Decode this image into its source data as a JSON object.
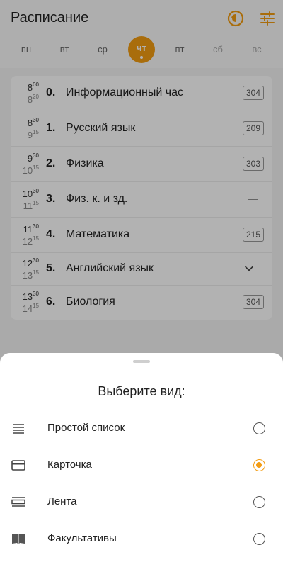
{
  "header": {
    "title": "Расписание"
  },
  "days": [
    {
      "label": "пн",
      "state": "normal"
    },
    {
      "label": "вт",
      "state": "normal"
    },
    {
      "label": "ср",
      "state": "normal"
    },
    {
      "label": "чт",
      "state": "active"
    },
    {
      "label": "пт",
      "state": "normal"
    },
    {
      "label": "сб",
      "state": "muted"
    },
    {
      "label": "вс",
      "state": "muted"
    }
  ],
  "lessons": [
    {
      "start_h": "8",
      "start_m": "00",
      "end_h": "8",
      "end_m": "20",
      "num": "0.",
      "subject": "Информационный час",
      "room": "304"
    },
    {
      "start_h": "8",
      "start_m": "30",
      "end_h": "9",
      "end_m": "15",
      "num": "1.",
      "subject": "Русский язык",
      "room": "209"
    },
    {
      "start_h": "9",
      "start_m": "30",
      "end_h": "10",
      "end_m": "15",
      "num": "2.",
      "subject": "Физика",
      "room": "303"
    },
    {
      "start_h": "10",
      "start_m": "30",
      "end_h": "11",
      "end_m": "15",
      "num": "3.",
      "subject": "Физ. к. и зд.",
      "room": "—"
    },
    {
      "start_h": "11",
      "start_m": "30",
      "end_h": "12",
      "end_m": "15",
      "num": "4.",
      "subject": "Математика",
      "room": "215"
    },
    {
      "start_h": "12",
      "start_m": "30",
      "end_h": "13",
      "end_m": "15",
      "num": "5.",
      "subject": "Английский язык",
      "room": ""
    },
    {
      "start_h": "13",
      "start_m": "30",
      "end_h": "14",
      "end_m": "15",
      "num": "6.",
      "subject": "Биология",
      "room": "304"
    }
  ],
  "sheet": {
    "title": "Выберите вид:",
    "options": [
      {
        "label": "Простой список",
        "icon": "list-icon",
        "selected": false
      },
      {
        "label": "Карточка",
        "icon": "card-icon",
        "selected": true
      },
      {
        "label": "Лента",
        "icon": "feed-icon",
        "selected": false
      },
      {
        "label": "Факультативы",
        "icon": "book-icon",
        "selected": false
      }
    ]
  },
  "colors": {
    "accent": "#f39c12",
    "scrim": "rgba(0,0,0,0.30)"
  }
}
